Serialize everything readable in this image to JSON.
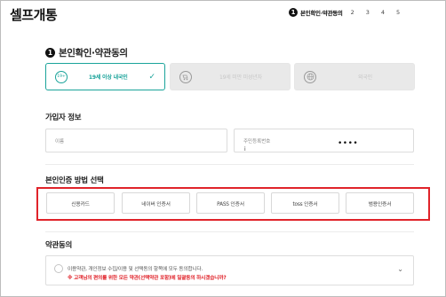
{
  "header": {
    "title": "셀프개통",
    "steps": {
      "active_number": "1",
      "active_label": "본인확인·약관동의",
      "others": [
        "2",
        "3",
        "4",
        "5"
      ]
    }
  },
  "identity_section": {
    "number": "1",
    "title": "본인확인·약관동의",
    "types": [
      {
        "label": "19세 이상 내국인",
        "icon": "id-card-icon",
        "icon_text": "19+",
        "selected": true
      },
      {
        "label": "19세 미만 미성년자",
        "icon": "stroller-icon",
        "selected": false
      },
      {
        "label": "외국인",
        "icon": "globe-icon",
        "selected": false
      }
    ],
    "accent_color": "#1aa39a"
  },
  "subscriber_info": {
    "title": "가입자 정보",
    "name_placeholder": "이름",
    "rrn_placeholder": "주민등록번호",
    "rrn_masked": "••••"
  },
  "auth_method": {
    "title": "본인인증 방법 선택",
    "options": [
      "신용카드",
      "네이버 인증서",
      "PASS 인증서",
      "toss 인증서",
      "범용인증서"
    ],
    "highlight_color": "#e0232a"
  },
  "terms": {
    "title": "약관동의",
    "line1": "이용약관, 개인정보 수집/이용 및 선택동의 항목에 모두 동의합니다.",
    "line2": "※ 고객님의 편의를 위한 모든 약관(선택약관 포함)에 일괄동의 하시겠습니까?"
  }
}
